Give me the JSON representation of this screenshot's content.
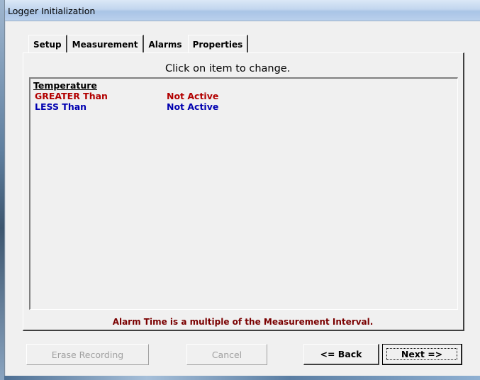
{
  "window": {
    "title": "Logger Initialization"
  },
  "tabs": [
    {
      "label": "Setup",
      "active": false
    },
    {
      "label": "Measurement",
      "active": false
    },
    {
      "label": "Alarms",
      "active": true
    },
    {
      "label": "Properties",
      "active": false
    }
  ],
  "alarms": {
    "instruction": "Click on item to change.",
    "group_header": "Temperature",
    "items": [
      {
        "condition": "GREATER Than",
        "state": "Not Active",
        "color": "#b20000"
      },
      {
        "condition": "LESS Than",
        "state": "Not Active",
        "color": "#0000b0"
      }
    ],
    "footnote": "Alarm Time is a multiple of the Measurement Interval."
  },
  "buttons": {
    "erase": {
      "label": "Erase Recording",
      "enabled": false
    },
    "cancel": {
      "label": "Cancel",
      "enabled": false
    },
    "back": {
      "label": "<= Back",
      "enabled": true
    },
    "next": {
      "label": "Next =>",
      "enabled": true,
      "default": true
    }
  }
}
